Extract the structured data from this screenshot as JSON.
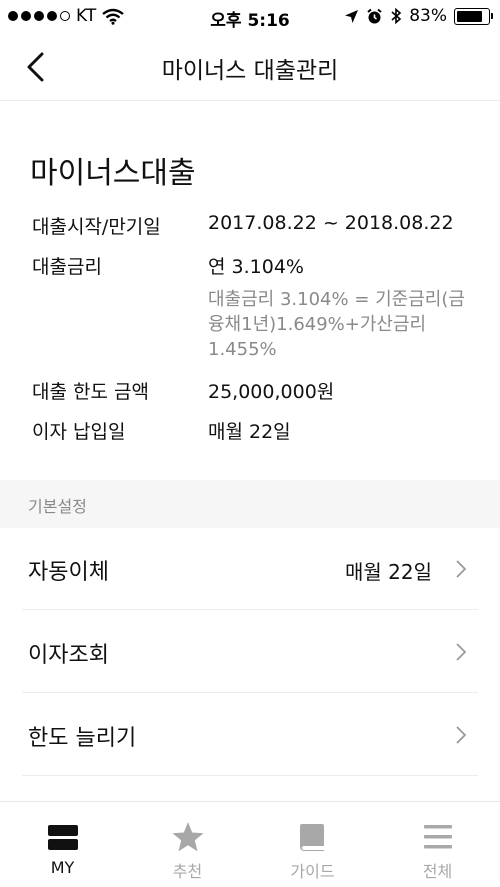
{
  "status_bar": {
    "carrier": "KT",
    "time": "오후 5:16",
    "battery": "83%",
    "battery_level": 0.83
  },
  "nav": {
    "title": "마이너스 대출관리"
  },
  "loan": {
    "title": "마이너스대출",
    "rows": [
      {
        "label": "대출시작/만기일",
        "value": "2017.08.22 ~ 2018.08.22"
      },
      {
        "label": "대출금리",
        "value": "연 3.104%"
      },
      {
        "label": "대출 한도 금액",
        "value": "25,000,000원"
      },
      {
        "label": "이자 납입일",
        "value": "매월 22일"
      }
    ],
    "rate_note": "대출금리 3.104% = 기준금리(금융채1년)1.649%+가산금리 1.455%"
  },
  "section": {
    "title": "기본설정"
  },
  "menu": [
    {
      "label": "자동이체",
      "value": "매월 22일"
    },
    {
      "label": "이자조회",
      "value": ""
    },
    {
      "label": "한도 늘리기",
      "value": ""
    }
  ],
  "tabs": [
    {
      "label": "MY",
      "icon": "my-icon",
      "active": true
    },
    {
      "label": "추천",
      "icon": "star-icon",
      "active": false
    },
    {
      "label": "가이드",
      "icon": "book-icon",
      "active": false
    },
    {
      "label": "전체",
      "icon": "menu-icon",
      "active": false
    }
  ]
}
